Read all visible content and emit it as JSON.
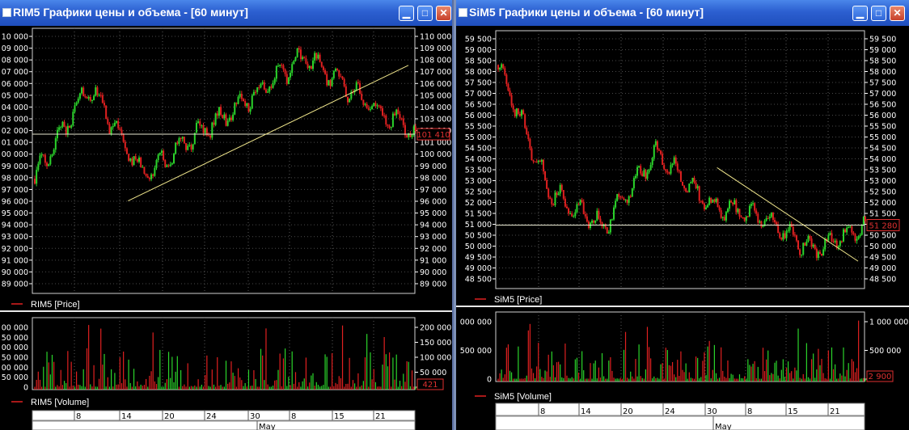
{
  "windows": [
    {
      "id": "rim5",
      "title": "RIM5 Графики цены и объема - [60 минут]",
      "price_legend": "RIM5 [Price]",
      "volume_legend": "RIM5 [Volume]",
      "price_tag": "101 410",
      "volume_tag": "421",
      "date_labels": [
        "8",
        "14",
        "20",
        "24",
        "30",
        "8",
        "15",
        "21"
      ],
      "month_label": "May",
      "left_price_ticks": [
        "10 000",
        "09 000",
        "08 000",
        "07 000",
        "06 000",
        "05 000",
        "04 000",
        "03 000",
        "02 000",
        "01 000",
        "00 000",
        "99 000",
        "98 000",
        "97 000",
        "96 000",
        "95 000",
        "94 000",
        "93 000",
        "92 000",
        "91 000",
        "90 000",
        "89 000"
      ],
      "right_price_ticks": [
        "110 000",
        "109 000",
        "108 000",
        "107 000",
        "106 000",
        "105 000",
        "104 000",
        "103 000",
        "102 000",
        "101 000",
        "100 000",
        "99 000",
        "98 000",
        "97 000",
        "96 000",
        "95 000",
        "94 000",
        "93 000",
        "92 000",
        "91 000",
        "90 000",
        "89 000"
      ],
      "left_volume_ticks": [
        "00 000",
        "50 000",
        "00 000",
        "50 000",
        "00 000",
        "50 000",
        "0"
      ],
      "right_volume_ticks": [
        "200 000",
        "150 000",
        "100 000",
        "50 000",
        "0"
      ]
    },
    {
      "id": "sim5",
      "title": "SiM5 Графики цены и объема - [60 минут]",
      "price_legend": "SiM5 [Price]",
      "volume_legend": "SiM5 [Volume]",
      "price_tag": "51 280",
      "volume_tag": "2 900",
      "date_labels": [
        "8",
        "14",
        "20",
        "24",
        "30",
        "8",
        "15",
        "21"
      ],
      "month_label": "May",
      "left_price_ticks": [
        "59 500",
        "59 000",
        "58 500",
        "58 000",
        "57 500",
        "57 000",
        "56 500",
        "56 000",
        "55 500",
        "55 000",
        "54 500",
        "54 000",
        "53 500",
        "53 000",
        "52 500",
        "52 000",
        "51 500",
        "51 000",
        "50 500",
        "50 000",
        "49 500",
        "49 000",
        "48 500"
      ],
      "right_price_ticks": [
        "59 500",
        "59 000",
        "58 500",
        "58 000",
        "57 500",
        "57 000",
        "56 500",
        "56 000",
        "55 500",
        "55 000",
        "54 500",
        "54 000",
        "53 500",
        "53 000",
        "52 500",
        "52 000",
        "51 500",
        "51 000",
        "50 500",
        "50 000",
        "49 500",
        "49 000",
        "48 500"
      ],
      "left_volume_ticks": [
        "000 000",
        "500 000",
        "0"
      ],
      "right_volume_ticks": [
        "1 000 000",
        "500 000",
        "0"
      ]
    }
  ],
  "chart_data": [
    {
      "type": "line",
      "series": [
        {
          "name": "RIM5 [Price]",
          "x": [
            "8",
            "14",
            "20",
            "24",
            "30",
            "8",
            "15",
            "21"
          ],
          "values": [
            97800,
            105400,
            98000,
            101500,
            104500,
            107800,
            104200,
            101410
          ]
        }
      ],
      "ylim": [
        88500,
        110000
      ],
      "last_value": 101410,
      "trendline": {
        "from": 96000,
        "to": 107000
      },
      "horizontal_level": 101410
    },
    {
      "type": "bar",
      "series": [
        {
          "name": "RIM5 [Volume]"
        }
      ],
      "ylim": [
        0,
        210000
      ],
      "last_value": 421
    },
    {
      "type": "line",
      "series": [
        {
          "name": "SiM5 [Price]",
          "x": [
            "8",
            "14",
            "20",
            "24",
            "30",
            "8",
            "15",
            "21"
          ],
          "values": [
            58300,
            52700,
            51200,
            54500,
            52200,
            51600,
            50200,
            51280
          ]
        }
      ],
      "ylim": [
        48500,
        59800
      ],
      "last_value": 51280,
      "trendline": {
        "from": 53800,
        "to": 49700
      },
      "horizontal_level": 51280
    },
    {
      "type": "bar",
      "series": [
        {
          "name": "SiM5 [Volume]"
        }
      ],
      "ylim": [
        0,
        1000000
      ],
      "last_value": 2900
    }
  ]
}
